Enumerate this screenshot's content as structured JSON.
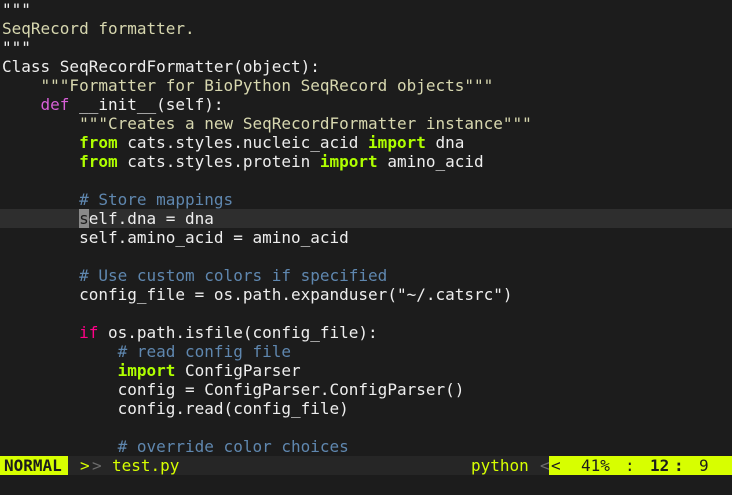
{
  "editor": {
    "lines": [
      {
        "segments": [
          {
            "t": "\"\"\"",
            "c": "plain"
          }
        ]
      },
      {
        "segments": [
          {
            "t": "SeqRecord formatter.",
            "c": "str"
          }
        ]
      },
      {
        "segments": [
          {
            "t": "\"\"\"",
            "c": "plain"
          }
        ]
      },
      {
        "segments": [
          {
            "t": "Class SeqRecordFormatter(object):",
            "c": "plain"
          }
        ]
      },
      {
        "segments": [
          {
            "t": "    \"\"\"Formatter for BioPython SeqRecord objects\"\"\"",
            "c": "str"
          }
        ]
      },
      {
        "segments": [
          {
            "t": "    ",
            "c": "plain"
          },
          {
            "t": "def",
            "c": "def"
          },
          {
            "t": " __init__(self):",
            "c": "plain"
          }
        ]
      },
      {
        "segments": [
          {
            "t": "        \"\"\"Creates a new SeqRecordFormatter instance\"\"\"",
            "c": "str"
          }
        ]
      },
      {
        "segments": [
          {
            "t": "        ",
            "c": "plain"
          },
          {
            "t": "from",
            "c": "kw"
          },
          {
            "t": " cats.styles.nucleic_acid ",
            "c": "plain"
          },
          {
            "t": "import",
            "c": "kw"
          },
          {
            "t": " dna",
            "c": "plain"
          }
        ]
      },
      {
        "segments": [
          {
            "t": "        ",
            "c": "plain"
          },
          {
            "t": "from",
            "c": "kw"
          },
          {
            "t": " cats.styles.protein ",
            "c": "plain"
          },
          {
            "t": "import",
            "c": "kw"
          },
          {
            "t": " amino_acid",
            "c": "plain"
          }
        ]
      },
      {
        "segments": [
          {
            "t": "",
            "c": "plain"
          }
        ]
      },
      {
        "segments": [
          {
            "t": "        # Store mappings",
            "c": "cmt"
          }
        ]
      },
      {
        "cursorline": true,
        "segments": [
          {
            "t": "        ",
            "c": "plain"
          },
          {
            "t": "s",
            "c": "cursor"
          },
          {
            "t": "elf.dna = dna",
            "c": "plain"
          }
        ]
      },
      {
        "segments": [
          {
            "t": "        self.amino_acid = amino_acid",
            "c": "plain"
          }
        ]
      },
      {
        "segments": [
          {
            "t": "",
            "c": "plain"
          }
        ]
      },
      {
        "segments": [
          {
            "t": "        # Use custom colors if specified",
            "c": "cmt"
          }
        ]
      },
      {
        "segments": [
          {
            "t": "        config_file = os.path.expanduser(\"~/.catsrc\")",
            "c": "plain"
          }
        ]
      },
      {
        "segments": [
          {
            "t": "",
            "c": "plain"
          }
        ]
      },
      {
        "segments": [
          {
            "t": "        ",
            "c": "plain"
          },
          {
            "t": "if",
            "c": "if"
          },
          {
            "t": " os.path.isfile(config_file):",
            "c": "plain"
          }
        ]
      },
      {
        "segments": [
          {
            "t": "            # read config file",
            "c": "cmt"
          }
        ]
      },
      {
        "segments": [
          {
            "t": "            ",
            "c": "plain"
          },
          {
            "t": "import",
            "c": "kw"
          },
          {
            "t": " ConfigParser",
            "c": "plain"
          }
        ]
      },
      {
        "segments": [
          {
            "t": "            config = ConfigParser.ConfigParser()",
            "c": "plain"
          }
        ]
      },
      {
        "segments": [
          {
            "t": "            config.read(config_file)",
            "c": "plain"
          }
        ]
      },
      {
        "segments": [
          {
            "t": "",
            "c": "plain"
          }
        ]
      },
      {
        "segments": [
          {
            "t": "            # override color choices",
            "c": "cmt"
          }
        ]
      }
    ]
  },
  "statusline": {
    "mode": "NORMAL",
    "sep_left_1": ">",
    "sep_left_2": ">",
    "filename": "test.py",
    "filetype": "python",
    "sep_right_1": "<",
    "sep_right_2": "<",
    "percent": "41%",
    "colon_1": ":",
    "line": "12",
    "colon_2": ":",
    "column": "9"
  },
  "colors": {
    "mode_bg": "#d7ff00",
    "keyword": "#afff00",
    "def_keyword": "#d75fd7",
    "if_keyword": "#ff0087",
    "comment": "#5f87af",
    "string": "#d7d7af",
    "background": "#1c1c1c"
  }
}
